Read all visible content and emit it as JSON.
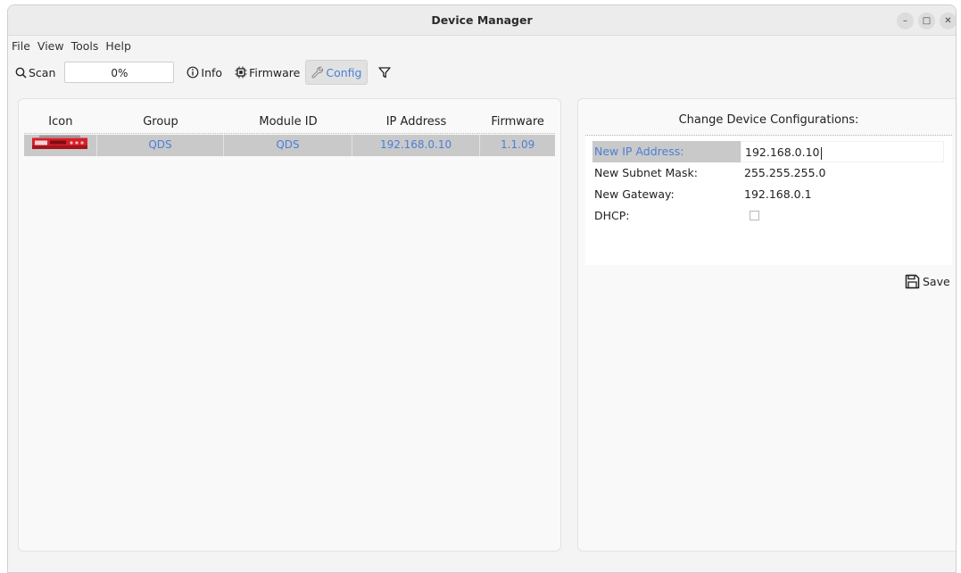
{
  "window": {
    "title": "Device Manager"
  },
  "menu": [
    "File",
    "View",
    "Tools",
    "Help"
  ],
  "toolbar": {
    "scan_label": "Scan",
    "progress_text": "0%",
    "progress_value": 0,
    "info_label": "Info",
    "firmware_label": "Firmware",
    "config_label": "Config",
    "filter_icon": "filter-icon"
  },
  "device_table": {
    "columns": [
      "Icon",
      "Group",
      "Module ID",
      "IP Address",
      "Firmware"
    ],
    "rows": [
      {
        "icon": "device-image-icon",
        "group": "QDS",
        "module_id": "QDS",
        "ip_address": "192.168.0.10",
        "firmware": "1.1.09"
      }
    ]
  },
  "config": {
    "title": "Change Device Configurations:",
    "fields": [
      {
        "label": "New IP Address:",
        "value": "192.168.0.10"
      },
      {
        "label": "New Subnet Mask:",
        "value": "255.255.255.0"
      },
      {
        "label": "New Gateway:",
        "value": "192.168.0.1"
      },
      {
        "label": "DHCP:",
        "checked": false
      }
    ],
    "save_label": "Save"
  },
  "colors": {
    "accent": "#4a7fd8",
    "selection": "#c9c9c9",
    "device_red": "#d8202a"
  }
}
